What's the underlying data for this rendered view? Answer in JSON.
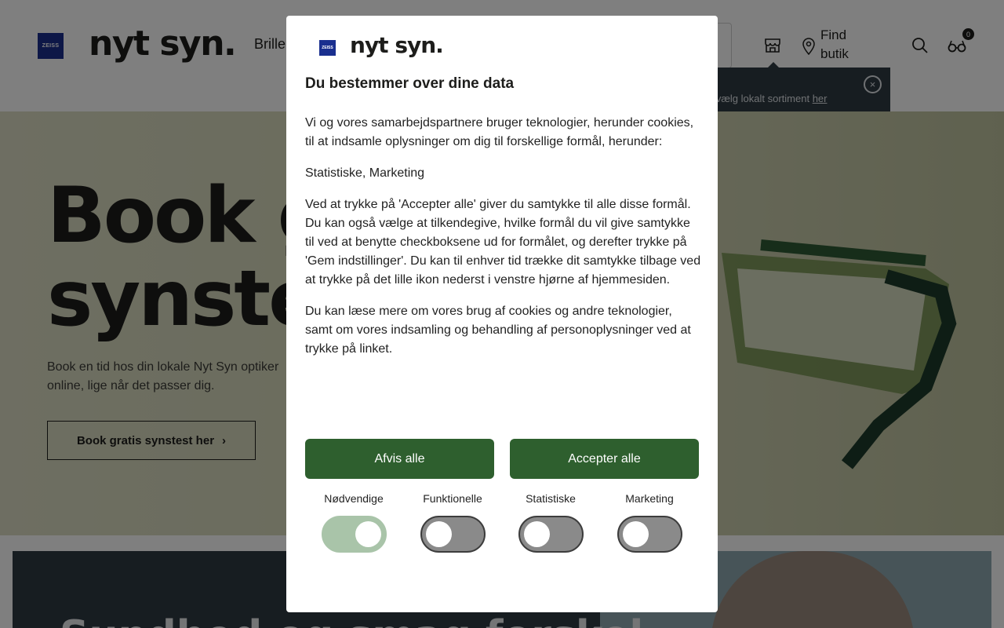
{
  "header": {
    "zeiss_logo_text": "ZEISS",
    "brand": "nyt syn.",
    "nav_item": "Brille",
    "find_store": "Find butik",
    "cart_count": "0"
  },
  "tooltip": {
    "text": "g vælg lokalt sortiment",
    "link": "her",
    "close_icon": "×"
  },
  "hero": {
    "title_line1": "Book g",
    "title_line2": "synstes",
    "subtitle": "Book en tid hos din lokale Nyt Syn optiker online, lige når det passer dig.",
    "button_label": "Book gratis synstest her",
    "button_icon": "›"
  },
  "section2": {
    "title": "Sundhed og smag forskel"
  },
  "dialog": {
    "zeiss_logo_text": "ZEISS",
    "brand": "nyt syn.",
    "title": "Du bestemmer over dine data",
    "paragraphs": [
      "Vi og vores samarbejdspartnere bruger teknologier, herunder cookies, til at indsamle oplysninger om dig til forskellige formål, herunder:",
      "Statistiske, Marketing",
      "Ved at trykke på 'Accepter alle' giver du samtykke til alle disse formål. Du kan også vælge at tilkendegive, hvilke formål du vil give samtykke til ved at benytte checkboksene ud for formålet, og derefter trykke på 'Gem indstillinger'. Du kan til enhver tid trække dit samtykke tilbage ved at trykke på det lille ikon nederst i venstre hjørne af hjemmesiden.",
      "Du kan læse mere om vores brug af cookies og andre teknologier, samt om vores indsamling og behandling af personoplysninger ved at trykke på linket."
    ],
    "reject_label": "Afvis alle",
    "accept_label": "Accepter alle",
    "toggles": [
      {
        "label": "Nødvendige",
        "on": true
      },
      {
        "label": "Funktionelle",
        "on": false
      },
      {
        "label": "Statistiske",
        "on": false
      },
      {
        "label": "Marketing",
        "on": false
      }
    ]
  },
  "colors": {
    "primary_green": "#2e5f2e",
    "toggle_on": "#a9c4a9",
    "zeiss_blue": "#1a2f8f",
    "tooltip_bg": "#2e3a43"
  }
}
